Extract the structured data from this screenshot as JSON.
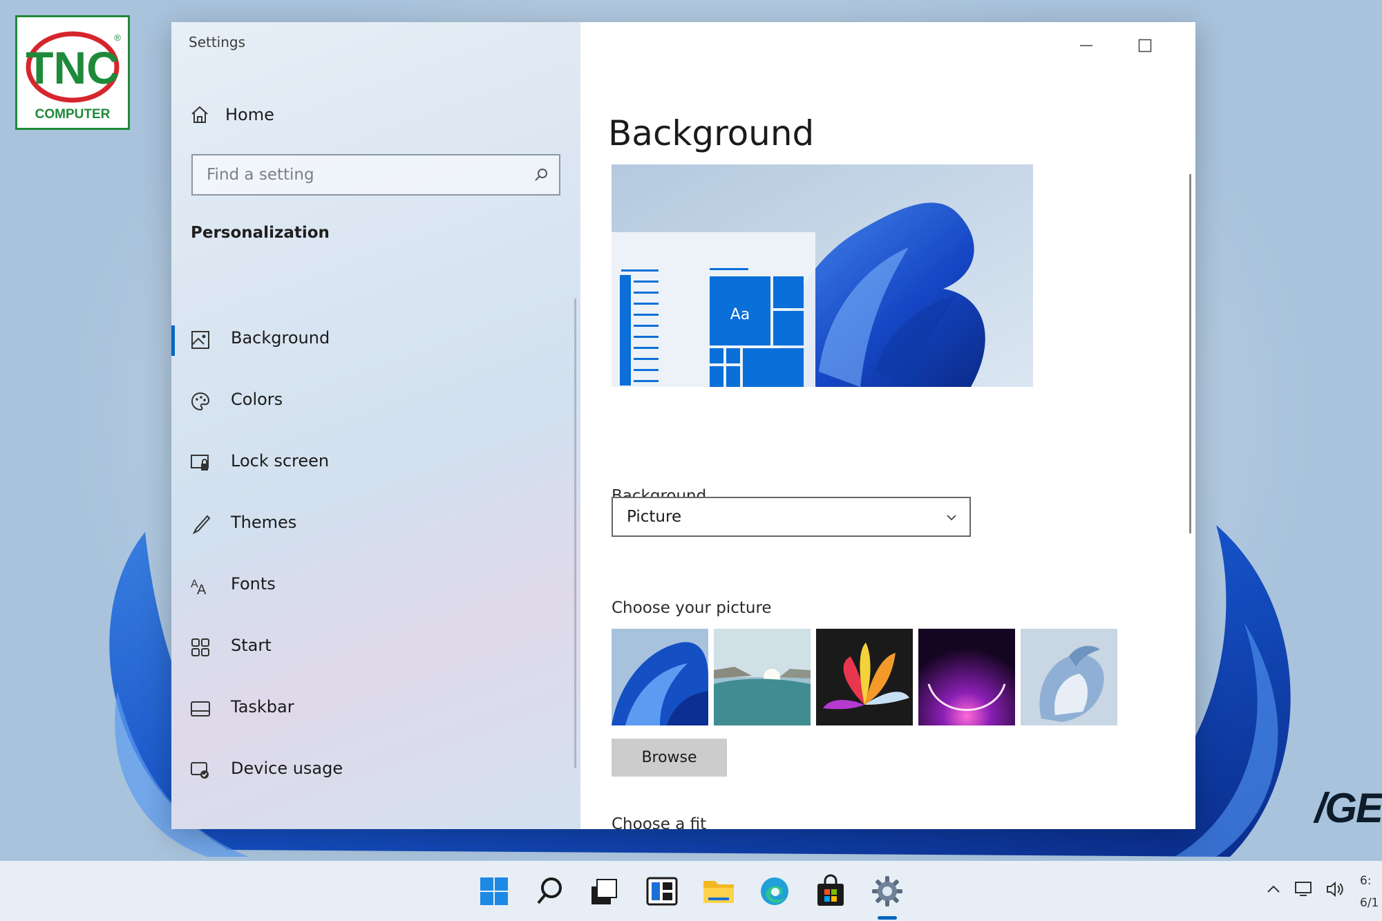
{
  "window": {
    "title": "Settings"
  },
  "sidebar": {
    "home_label": "Home",
    "search_placeholder": "Find a setting",
    "section_heading": "Personalization",
    "items": [
      {
        "label": "Background",
        "icon": "picture-icon",
        "active": true
      },
      {
        "label": "Colors",
        "icon": "palette-icon"
      },
      {
        "label": "Lock screen",
        "icon": "lock-screen-icon"
      },
      {
        "label": "Themes",
        "icon": "brush-icon"
      },
      {
        "label": "Fonts",
        "icon": "font-icon"
      },
      {
        "label": "Start",
        "icon": "start-grid-icon"
      },
      {
        "label": "Taskbar",
        "icon": "taskbar-icon"
      },
      {
        "label": "Device usage",
        "icon": "device-usage-icon"
      }
    ]
  },
  "content": {
    "page_title": "Background",
    "preview_tile_text": "Aa",
    "background_label": "Background",
    "background_value": "Picture",
    "choose_picture_label": "Choose your picture",
    "browse_label": "Browse",
    "choose_fit_label": "Choose a fit"
  },
  "logo": {
    "top": "TNC",
    "bottom": "COMPUTER",
    "registered": "®"
  },
  "watermark": "/GE",
  "taskbar": {
    "icons": [
      "windows-start-icon",
      "search-icon",
      "task-view-icon",
      "widgets-icon",
      "file-explorer-icon",
      "edge-icon",
      "store-icon",
      "settings-icon"
    ],
    "active": "settings-icon",
    "tray_icons": [
      "chevron-up-icon",
      "network-icon",
      "volume-icon"
    ],
    "time": "6:",
    "date": "6/1"
  },
  "colors": {
    "accent": "#0067c0",
    "tile_blue": "#0a6fd8",
    "brand_green": "#1f8a3a",
    "brand_red": "#d6262d"
  }
}
